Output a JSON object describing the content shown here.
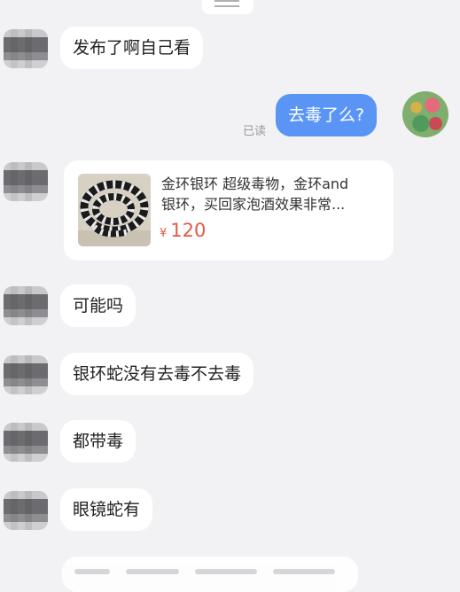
{
  "messages": [
    {
      "id": "m1",
      "text": "发布了啊自己看"
    },
    {
      "id": "m2",
      "text": "去毒了么?",
      "read": "已读"
    },
    {
      "id": "m4",
      "text": "可能吗"
    },
    {
      "id": "m5",
      "text": "银环蛇没有去毒不去毒"
    },
    {
      "id": "m6",
      "text": "都带毒"
    },
    {
      "id": "m7",
      "text": "眼镜蛇有"
    }
  ],
  "product": {
    "title_line1": "金环银环 超级毒物，金环and",
    "title_line2": "银环，买回家泡酒效果非常...",
    "currency": "¥",
    "price": "120"
  },
  "colors": {
    "background": "#f2f2f4",
    "outgoing_bubble": "#5a95f5",
    "price": "#e25945"
  }
}
